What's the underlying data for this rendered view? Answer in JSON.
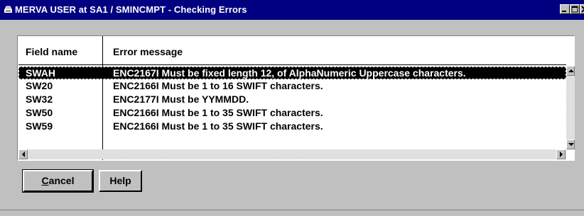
{
  "window": {
    "title": "MERVA USER at SA1 / SMINCMPT - Checking Errors",
    "controls": {
      "minimize": "_",
      "maximize": "□",
      "close": "×"
    }
  },
  "table": {
    "columns": [
      "Field name",
      "Error message"
    ],
    "rows": [
      {
        "field": "SWAH",
        "message": "ENC2167I Must be fixed length 12, of AlphaNumeric Uppercase characters.",
        "selected": true
      },
      {
        "field": "SW20",
        "message": "ENC2166I Must be 1 to 16 SWIFT characters.",
        "selected": false
      },
      {
        "field": "SW32",
        "message": "ENC2177I Must be YYMMDD.",
        "selected": false
      },
      {
        "field": "SW50",
        "message": "ENC2166I Must be 1 to 35 SWIFT characters.",
        "selected": false
      },
      {
        "field": "SW59",
        "message": "ENC2166I Must be 1 to 35 SWIFT characters.",
        "selected": false
      }
    ]
  },
  "buttons": {
    "cancel": {
      "label": "Cancel",
      "mnemonic": "C",
      "rest": "ancel"
    },
    "help": {
      "label": "Help"
    }
  },
  "colors": {
    "titlebar": "#000080",
    "face": "#c0c0c0",
    "selection": "#000000"
  }
}
